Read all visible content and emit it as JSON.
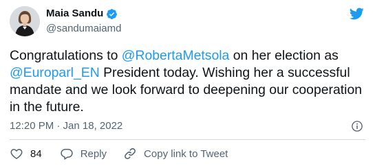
{
  "author": {
    "name": "Maia Sandu",
    "handle": "@sandumaiamd"
  },
  "tweet": {
    "segments": [
      {
        "text": "Congratulations to ",
        "type": "text"
      },
      {
        "text": "@RobertaMetsola",
        "type": "mention"
      },
      {
        "text": " on her election as ",
        "type": "text"
      },
      {
        "text": "@Europarl_EN",
        "type": "mention"
      },
      {
        "text": " President today. Wishing her a successful mandate and we look forward to deepening our cooperation in the future.",
        "type": "text"
      }
    ],
    "timestamp": "12:20 PM · Jan 18, 2022"
  },
  "actions": {
    "like_count": "84",
    "reply_label": "Reply",
    "copy_label": "Copy link to Tweet"
  },
  "colors": {
    "accent": "#1d9bf0",
    "text": "#0f1419",
    "secondary": "#536471",
    "divider": "#cfd9de"
  },
  "icons": [
    "avatar",
    "verified-badge-icon",
    "twitter-bird-icon",
    "info-icon",
    "heart-icon",
    "reply-icon",
    "link-icon"
  ]
}
